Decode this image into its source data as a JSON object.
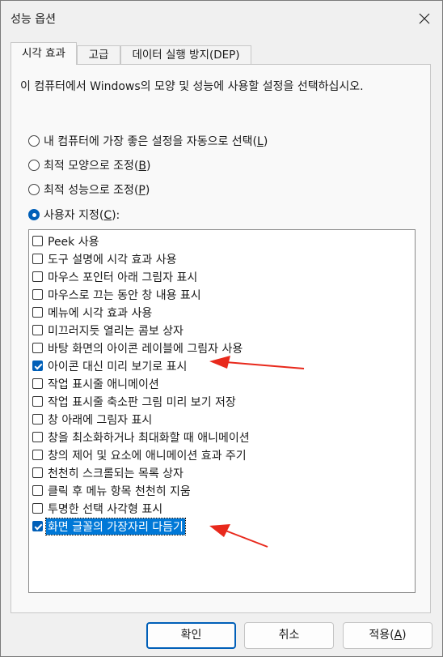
{
  "window": {
    "title": "성능 옵션",
    "close_icon": "close-icon"
  },
  "tabs": [
    {
      "label": "시각 효과",
      "active": true
    },
    {
      "label": "고급",
      "active": false
    },
    {
      "label": "데이터 실행 방지(DEP)",
      "active": false
    }
  ],
  "description": "이 컴퓨터에서 Windows의 모양 및 성능에 사용할 설정을 선택하십시오.",
  "radios": [
    {
      "prefix": "내 컴퓨터에 가장 좋은 설정을 자동으로 선택(",
      "key": "L",
      "suffix": ")",
      "checked": false
    },
    {
      "prefix": "최적 모양으로 조정(",
      "key": "B",
      "suffix": ")",
      "checked": false
    },
    {
      "prefix": "최적 성능으로 조정(",
      "key": "P",
      "suffix": ")",
      "checked": false
    },
    {
      "prefix": "사용자 지정(",
      "key": "C",
      "suffix": "):",
      "checked": true
    }
  ],
  "options": [
    {
      "label": "Peek 사용",
      "checked": false
    },
    {
      "label": "도구 설명에 시각 효과 사용",
      "checked": false
    },
    {
      "label": "마우스 포인터 아래 그림자 표시",
      "checked": false
    },
    {
      "label": "마우스로 끄는 동안 창 내용 표시",
      "checked": false
    },
    {
      "label": "메뉴에 시각 효과 사용",
      "checked": false
    },
    {
      "label": "미끄러지듯 열리는 콤보 상자",
      "checked": false
    },
    {
      "label": "바탕 화면의 아이콘 레이블에 그림자 사용",
      "checked": false
    },
    {
      "label": "아이콘 대신 미리 보기로 표시",
      "checked": true
    },
    {
      "label": "작업 표시줄 애니메이션",
      "checked": false
    },
    {
      "label": "작업 표시줄 축소판 그림 미리 보기 저장",
      "checked": false
    },
    {
      "label": "창 아래에 그림자 표시",
      "checked": false
    },
    {
      "label": "창을 최소화하거나 최대화할 때 애니메이션",
      "checked": false
    },
    {
      "label": "창의 제어 및 요소에 애니메이션 효과 주기",
      "checked": false
    },
    {
      "label": "천천히 스크롤되는 목록 상자",
      "checked": false
    },
    {
      "label": "클릭 후 메뉴 항목 천천히 지움",
      "checked": false
    },
    {
      "label": "투명한 선택 사각형 표시",
      "checked": false
    },
    {
      "label": "화면 글꼴의 가장자리 다듬기",
      "checked": true,
      "selected": true
    }
  ],
  "buttons": {
    "ok": "확인",
    "cancel": "취소",
    "apply_prefix": "적용(",
    "apply_key": "A",
    "apply_suffix": ")"
  },
  "colors": {
    "accent": "#005fb8",
    "annotation_arrow": "#e8291c"
  }
}
